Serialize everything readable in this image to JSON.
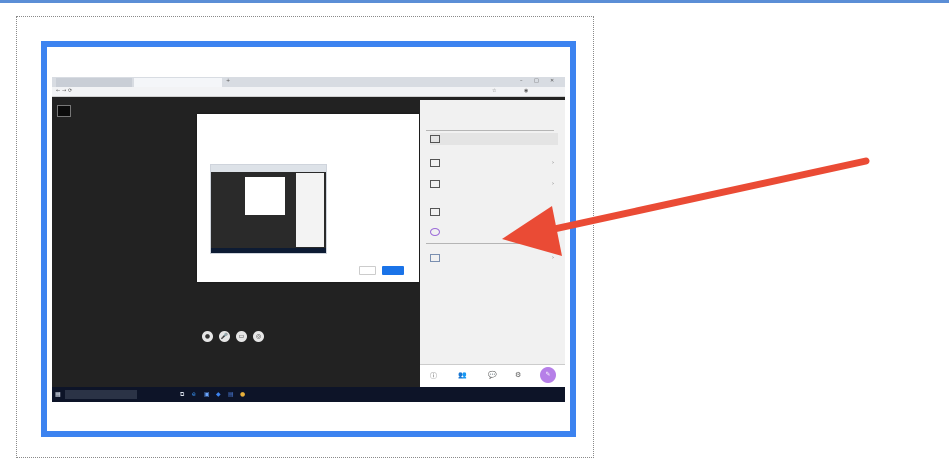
{
  "accent_color": "#3c83f0",
  "arrow_color": "#ea4b35",
  "browser": {
    "tabs": [
      {
        "label": "",
        "icon": "document-icon"
      },
      {
        "label": "",
        "icon": "video-call-icon"
      }
    ],
    "new_tab": "+",
    "window_controls": [
      "–",
      "□",
      "✕"
    ],
    "nav_icons": [
      "←",
      "→",
      "⟳"
    ],
    "url": ""
  },
  "dialog": {
    "title": "",
    "body": "",
    "link": "",
    "cancel": "",
    "share": ""
  },
  "meeting": {
    "notice": ""
  },
  "side_panel": {
    "heading": "",
    "subheading": "",
    "items": [
      {
        "label": "",
        "icon": "present-screen-icon",
        "chevron": ""
      },
      {
        "label": "",
        "icon": "window-icon",
        "chevron": "›"
      },
      {
        "label": "",
        "icon": "tab-icon",
        "chevron": "›"
      }
    ],
    "section_caption": "",
    "extras": [
      {
        "label": "",
        "icon": "whiteboard-icon"
      },
      {
        "label": "",
        "icon": "apps-icon"
      }
    ],
    "section_caption_2": "",
    "more": {
      "label": "",
      "icon": "activities-icon",
      "chevron": "›"
    },
    "bottom_icons": [
      "ⓘ",
      "👥",
      "💬",
      "⚙",
      "✎"
    ]
  },
  "media_controls": [
    "●",
    "🎤",
    "▭",
    "◎"
  ],
  "taskbar": {
    "start": "▦",
    "search_placeholder": "",
    "apps": [
      "⧉",
      "e",
      "▣",
      "◆",
      "▤",
      "●"
    ],
    "tray": ""
  }
}
